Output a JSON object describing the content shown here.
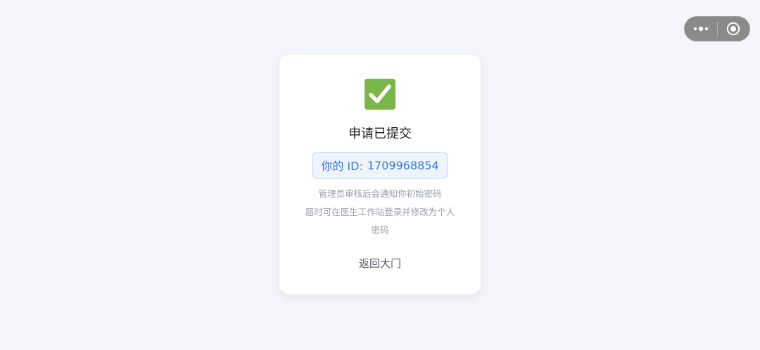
{
  "capsule": {
    "more_icon": "three-dots-icon",
    "close_icon": "target-circle-icon"
  },
  "card": {
    "icon": "green-check-box-icon",
    "icon_color": "#7ab648",
    "title": "申请已提交",
    "id_label": "你的 ID:",
    "id_value": "1709968854",
    "description": [
      "管理员审核后会通知你初始密码",
      "届时可在医生工作站登录并修改为个人",
      "密码"
    ],
    "back_label": "返回大门"
  },
  "colors": {
    "background": "#f4f5fa",
    "accent_blue": "#3a7bd5",
    "chip_bg": "#edf4fd",
    "chip_border": "#bcd4f4"
  }
}
